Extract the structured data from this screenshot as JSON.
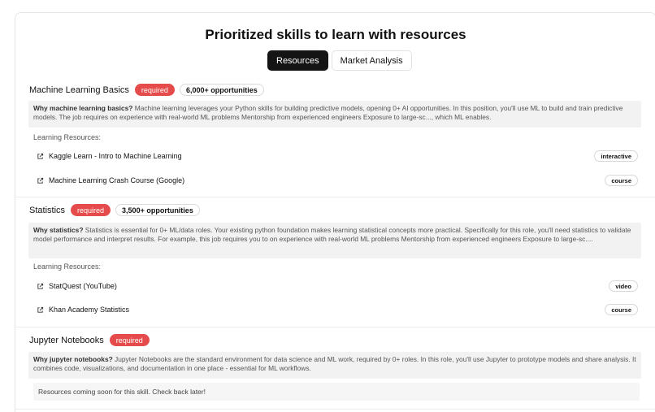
{
  "page": {
    "title": "Prioritized skills to learn with resources",
    "tabs": [
      {
        "label": "Resources",
        "active": true
      },
      {
        "label": "Market Analysis",
        "active": false
      }
    ]
  },
  "skills": [
    {
      "name": "Machine Learning Basics",
      "priority": "required",
      "opportunities": "6,000+ opportunities",
      "why_title": "Why machine learning basics?",
      "why_text": "Machine learning leverages your Python skills for building predictive models, opening 0+ AI opportunities. In this position, you'll use ML to build and train predictive models. The job requires on experience with real-world ML problems Mentorship from experienced engineers Exposure to large-sc..., which ML enables.",
      "resources_label": "Learning Resources:",
      "resources": [
        {
          "title": "Kaggle Learn - Intro to Machine Learning",
          "type": "interactive"
        },
        {
          "title": "Machine Learning Crash Course (Google)",
          "type": "course"
        }
      ]
    },
    {
      "name": "Statistics",
      "priority": "required",
      "opportunities": "3,500+ opportunities",
      "why_title": "Why statistics?",
      "why_text": "Statistics is essential for 0+ ML/data roles. Your existing python foundation makes learning statistical concepts more practical. Specifically for this role, you'll need statistics to validate model performance and interpret results. For example, this job requires you to on experience with real-world ML problems Mentorship from experienced engineers Exposure to large-sc....",
      "resources_label": "Learning Resources:",
      "resources": [
        {
          "title": "StatQuest (YouTube)",
          "type": "video"
        },
        {
          "title": "Khan Academy Statistics",
          "type": "course"
        }
      ]
    },
    {
      "name": "Jupyter Notebooks",
      "priority": "required",
      "why_title": "Why jupyter notebooks?",
      "why_text": "Jupyter Notebooks are the standard environment for data science and ML work, required by 0+ roles. In this role, you'll use Jupyter to prototype models and share analysis. It combines code, visualizations, and documentation in one place - essential for ML workflows.",
      "empty_message": "Resources coming soon for this skill. Check back later!"
    }
  ],
  "icons": {
    "resource_link": "external-link-icon"
  }
}
